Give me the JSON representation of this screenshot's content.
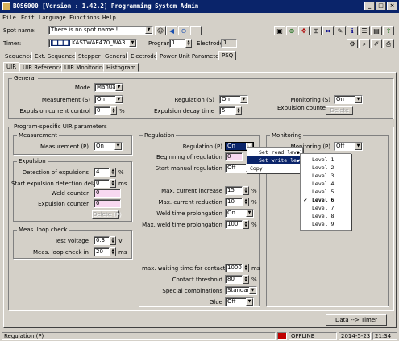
{
  "title": "BOS6000 [Version : 1.42.2] Programming System Admin",
  "menu": [
    "File",
    "Edit",
    "Language",
    "Functions",
    "Help"
  ],
  "spot": {
    "label": "Spot name:",
    "value": "There is no spot name !"
  },
  "timer": {
    "label": "Timer:",
    "badge": "■■■",
    "value": "KASTWAE470_WA3"
  },
  "program": {
    "label": "Program",
    "value": "1"
  },
  "electrode": {
    "label": "Electrode",
    "value": "1"
  },
  "tabs": [
    "Sequence",
    "Ext. Sequence",
    "Stepper",
    "General",
    "Electrode",
    "Power Unit Parameter",
    "PSQ"
  ],
  "subtabs": [
    "UIR",
    "UIR Reference",
    "UIR Monitoring",
    "Histogram"
  ],
  "general": {
    "title": "General",
    "mode": {
      "label": "Mode",
      "value": "Manual Gun"
    },
    "measurement_s": {
      "label": "Measurement (S)",
      "value": "On"
    },
    "expulsion_ctrl": {
      "label": "Expulsion current control",
      "value": "0",
      "unit": "%"
    },
    "regulation_s": {
      "label": "Regulation (S)",
      "value": "On"
    },
    "exp_decay": {
      "label": "Expulsion decay time",
      "value": "5"
    },
    "monitoring_s": {
      "label": "Monitoring (S)",
      "value": "On"
    },
    "exp_counter": {
      "label": "Expulsion counter",
      "button": "Delete"
    }
  },
  "program_specific": {
    "title": "Program-specific UIR parameters"
  },
  "measurement": {
    "title": "Measurement",
    "label": "Measurement (P)",
    "value": "On"
  },
  "expulsion": {
    "title": "Expulsion",
    "detection": {
      "label": "Detection of expulsions",
      "value": "4",
      "unit": "%"
    },
    "start_delay": {
      "label": "Start expulsion detection delay",
      "value": "0",
      "unit": "ms"
    },
    "weld_counter": {
      "label": "Weld counter",
      "value": "0"
    },
    "exp_counter": {
      "label": "Expulsion counter",
      "value": "0"
    },
    "button": "Delete (P)"
  },
  "meas_loop": {
    "title": "Meas. loop check",
    "test_voltage": {
      "label": "Test voltage",
      "value": "0.3",
      "unit": "V"
    },
    "check_in": {
      "label": "Meas. loop check in",
      "value": "20",
      "unit": "ms"
    }
  },
  "regulation": {
    "title": "Regulation",
    "reg_p": {
      "label": "Regulation (P)",
      "value": "On"
    },
    "beginning": {
      "label": "Beginning of regulation",
      "value": "0"
    },
    "start_manual": {
      "label": "Start manual regulation",
      "value": "Off"
    },
    "max_inc": {
      "label": "Max. current increase",
      "value": "15",
      "unit": "%"
    },
    "max_red": {
      "label": "Max. current reduction",
      "value": "10",
      "unit": "%"
    },
    "weld_prol": {
      "label": "Weld time prolongation",
      "value": "On"
    },
    "max_weld_prol": {
      "label": "Max. weld time prolongation",
      "value": "100",
      "unit": "%"
    },
    "max_wait": {
      "label": "max. waiting time for contact",
      "value": "1000",
      "unit": "ms"
    },
    "contact": {
      "label": "Contact threshold",
      "value": "80",
      "unit": "%"
    },
    "special": {
      "label": "Special combinations",
      "value": "Standard"
    },
    "glue": {
      "label": "Glue",
      "value": "Off"
    }
  },
  "monitoring": {
    "title": "Monitoring",
    "label": "Monitoring (P)",
    "value": "Off"
  },
  "context_menu": [
    "Set read level",
    "Set write level",
    "Copy"
  ],
  "levels": [
    "Level 1",
    "Level 2",
    "Level 3",
    "Level 4",
    "Level 5",
    "Level 6",
    "Level 7",
    "Level 8",
    "Level 9"
  ],
  "selected_level": "Level 6",
  "data_timer_button": "Data --> Timer",
  "status": {
    "left": "Regulation (P)",
    "state": "OFFLINE",
    "date": "2014-5-23",
    "time": "21:34"
  },
  "colors": {
    "titlebar": "#0a246a",
    "face": "#d4d0c8",
    "highlight": "#0a246a",
    "pink": "#f8d8f0"
  }
}
